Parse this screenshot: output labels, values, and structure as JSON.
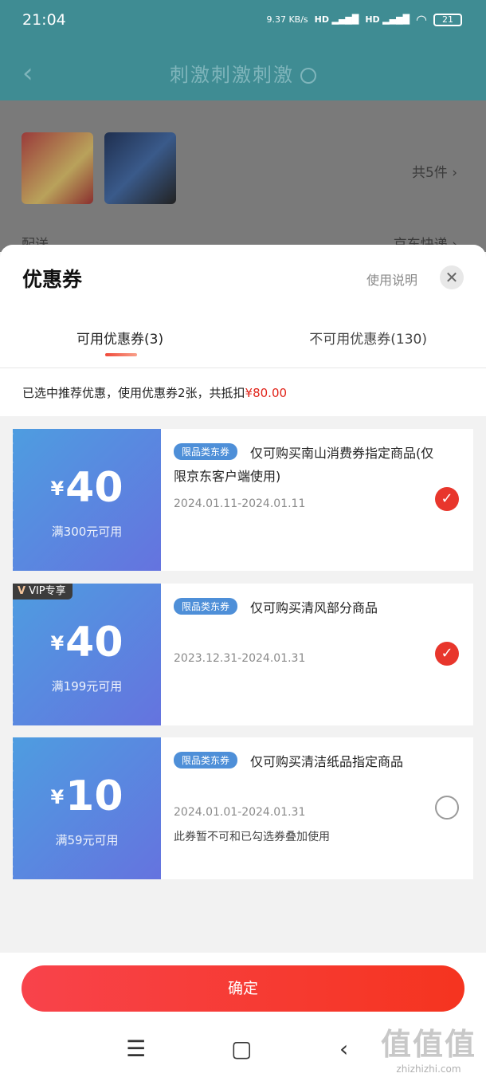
{
  "status_bar": {
    "time": "21:04",
    "net_speed": "9.37 KB/s",
    "hd1": "HD",
    "hd2": "HD",
    "battery": "21"
  },
  "header": {
    "title": "刺激刺激刺激"
  },
  "background": {
    "total_count": "共5件",
    "delivery_label": "配送",
    "delivery_value": "京东快递"
  },
  "sheet": {
    "title": "优惠券",
    "usage_link": "使用说明",
    "tabs": [
      {
        "label": "可用优惠券(3)"
      },
      {
        "label": "不可用优惠券(130)"
      }
    ],
    "summary_text": "已选中推荐优惠，使用优惠券2张，共抵扣",
    "summary_amount": "¥80.00"
  },
  "coupons": [
    {
      "currency": "¥",
      "amount": "40",
      "condition": "满300元可用",
      "tag": "限品类东券",
      "description": "仅可购买南山消费券指定商品(仅限京东客户端使用)",
      "dates": "2024.01.11-2024.01.11",
      "note": "",
      "selected": true
    },
    {
      "currency": "¥",
      "amount": "40",
      "condition": "满199元可用",
      "tag": "限品类东券",
      "description": "仅可购买清风部分商品",
      "dates": "2023.12.31-2024.01.31",
      "note": "",
      "selected": true,
      "badge": "VIP专享"
    },
    {
      "currency": "¥",
      "amount": "10",
      "condition": "满59元可用",
      "tag": "限品类东券",
      "description": "仅可购买清洁纸品指定商品",
      "dates": "2024.01.01-2024.01.31",
      "note": "此券暂不可和已勾选券叠加使用",
      "selected": false
    }
  ],
  "footer": {
    "confirm_label": "确定"
  },
  "watermark": {
    "big": "值值值",
    "small": "zhizhizhi.com"
  },
  "colors": {
    "accent_red": "#e8362c",
    "coupon_blue": "#4e9de0",
    "header_teal": "#3f8c93"
  }
}
